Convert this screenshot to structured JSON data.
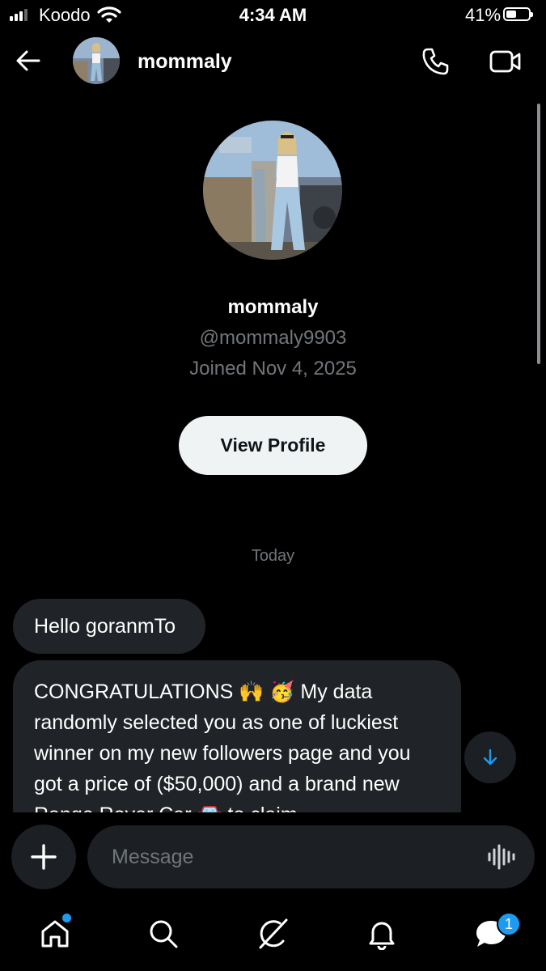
{
  "status_bar": {
    "carrier": "Koodo",
    "time": "4:34 AM",
    "battery_percent": "41%",
    "battery_level": 0.41
  },
  "header": {
    "username": "mommaly",
    "icons": [
      "back-arrow-icon",
      "phone-icon",
      "video-camera-icon"
    ]
  },
  "profile": {
    "display_name": "mommaly",
    "handle": "@mommaly9903",
    "joined": "Joined Nov 4, 2025",
    "view_profile_label": "View Profile"
  },
  "conversation": {
    "date_separator": "Today",
    "messages": [
      {
        "text": "Hello goranmTo"
      },
      {
        "text": "CONGRATULATIONS 🙌 🥳 My data randomly selected you as one of luckiest winner on my new followers page and you got a price  of ($50,000) and a brand new Range Rover Car 🚘 to claim"
      }
    ]
  },
  "composer": {
    "placeholder": "Message"
  },
  "bottom_nav": {
    "items": [
      "home-icon",
      "search-icon",
      "grok-icon",
      "notifications-bell-icon",
      "messages-icon"
    ],
    "messages_badge": "1"
  },
  "colors": {
    "background": "#000000",
    "bubble": "#202327",
    "muted_text": "#71767b",
    "accent": "#1d9bf0",
    "button_bg": "#eff3f4"
  }
}
